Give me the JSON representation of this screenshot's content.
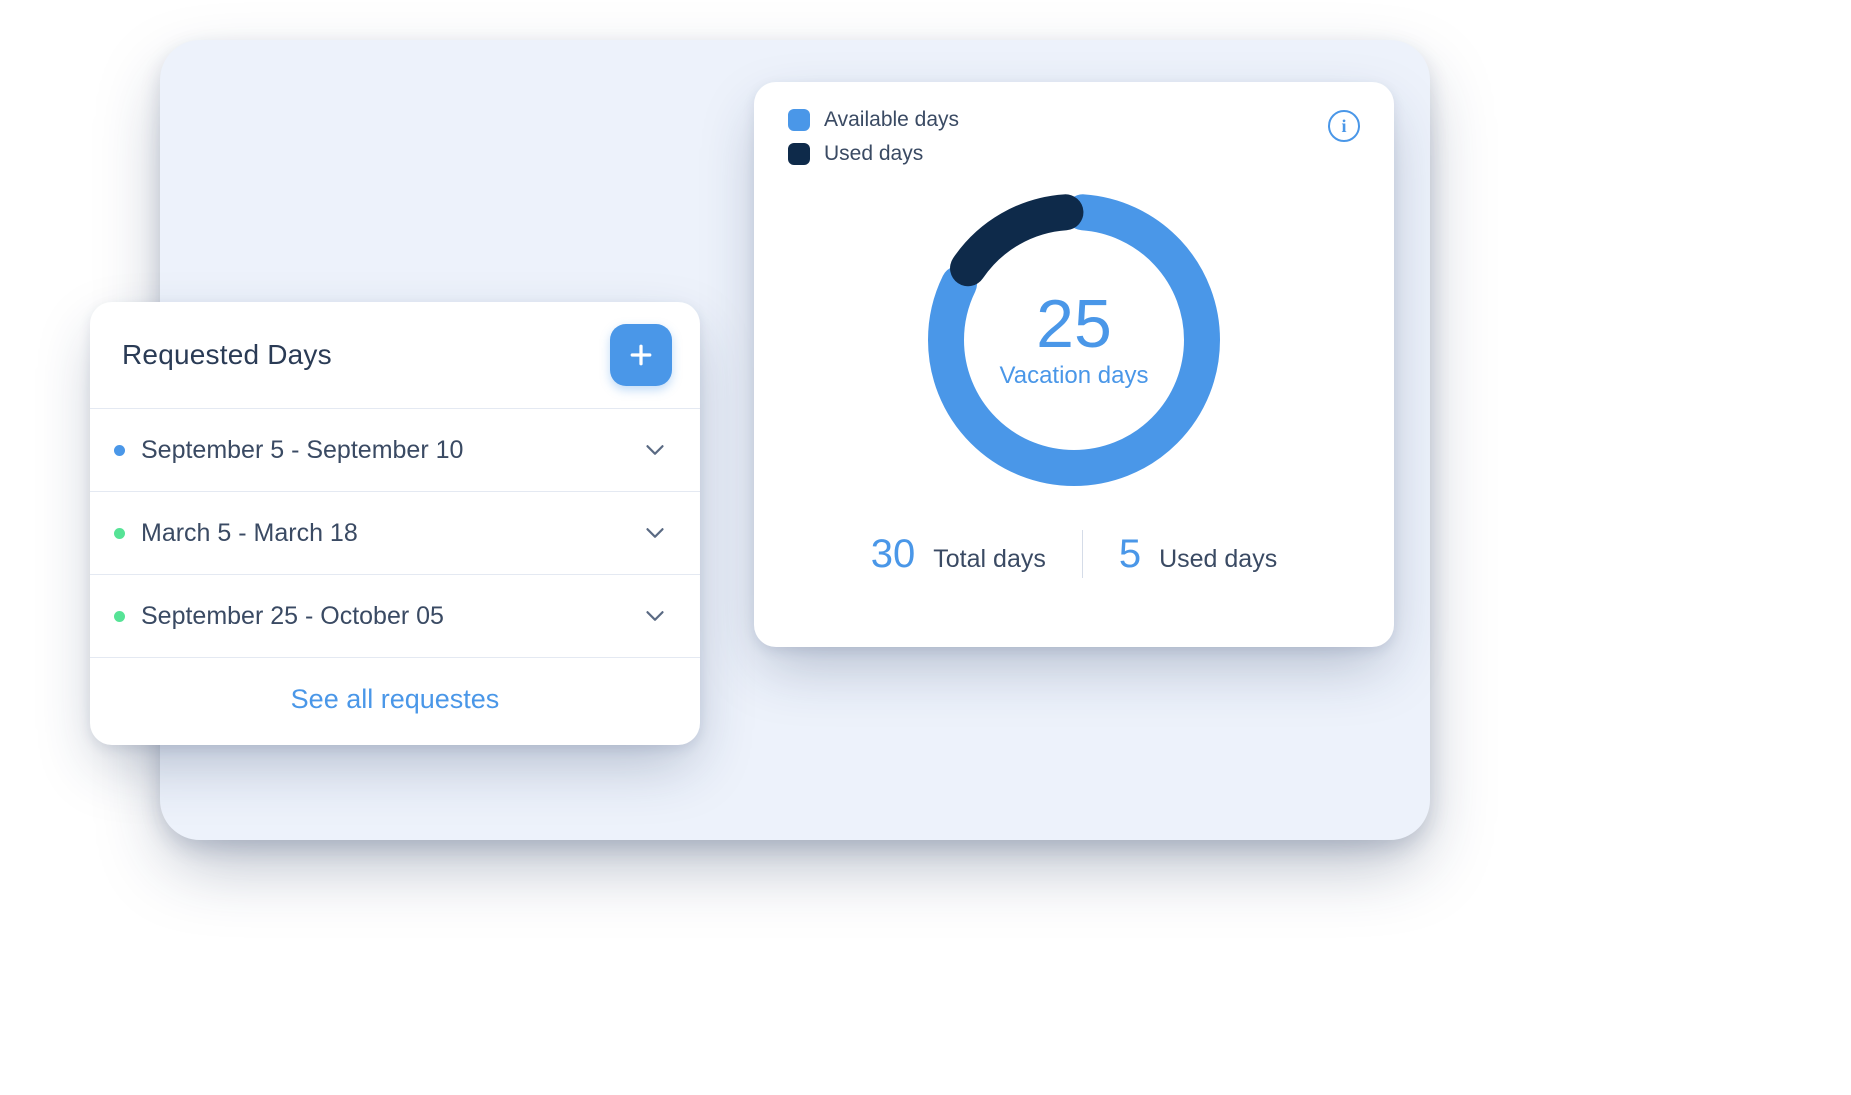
{
  "requests": {
    "title": "Requested Days",
    "items": [
      {
        "range": "September 5 - September 10",
        "status": "blue"
      },
      {
        "range": "March 5 - March 18",
        "status": "green"
      },
      {
        "range": "September 25 - October 05",
        "status": "green"
      }
    ],
    "see_all": "See all requestes"
  },
  "vacation": {
    "legend": {
      "available": "Available days",
      "used": "Used days"
    },
    "center_value": "25",
    "center_label": "Vacation days",
    "total": {
      "value": "30",
      "label": "Total days"
    },
    "used": {
      "value": "5",
      "label": "Used days"
    }
  },
  "colors": {
    "accent": "#4a97e8",
    "dark": "#0e2a4a",
    "green": "#56e396"
  },
  "chart_data": {
    "type": "pie",
    "title": "Vacation days",
    "series": [
      {
        "name": "Available days",
        "value": 25,
        "color": "#4a97e8"
      },
      {
        "name": "Used days",
        "value": 5,
        "color": "#0e2a4a"
      }
    ],
    "total": 30,
    "center_value": 25,
    "center_label": "Vacation days"
  }
}
